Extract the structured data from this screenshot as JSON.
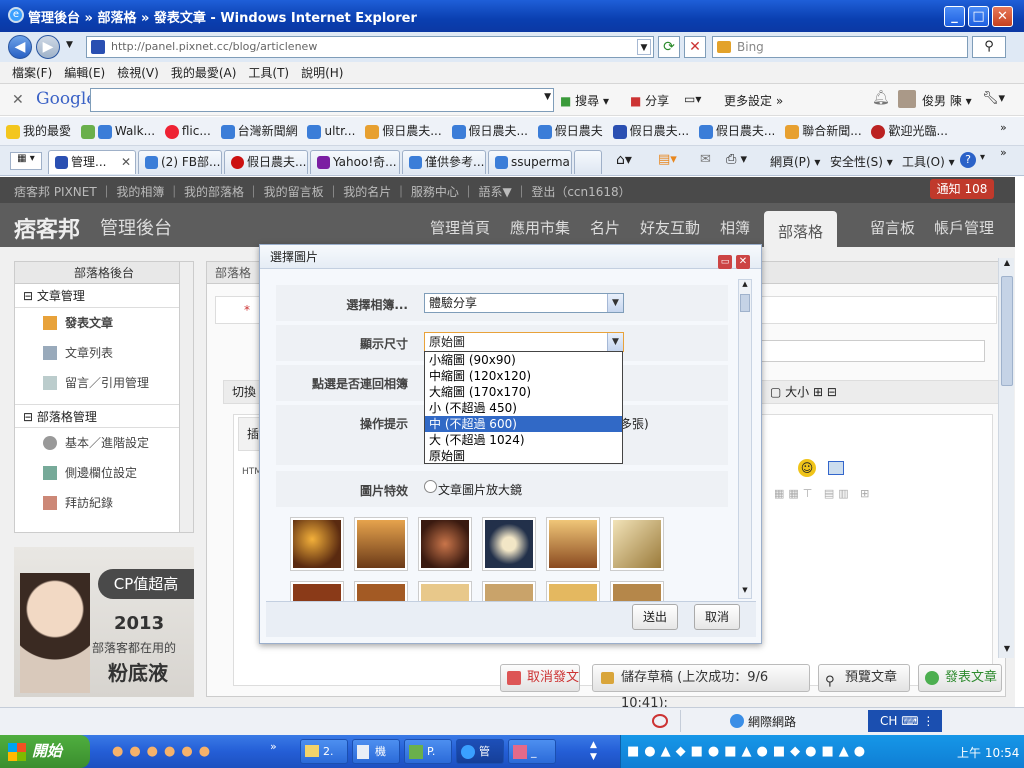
{
  "window": {
    "title": "管理後台 » 部落格 » 發表文章 - Windows Internet Explorer"
  },
  "address": {
    "url": "http://panel.pixnet.cc/blog/articlenew",
    "search_placeholder": "Bing"
  },
  "menubar": [
    "檔案(F)",
    "編輯(E)",
    "檢視(V)",
    "我的最愛(A)",
    "工具(T)",
    "說明(H)"
  ],
  "google_bar": {
    "logo": "Google",
    "search": "搜尋",
    "share": "分享",
    "more": "更多設定 »",
    "user": "俊男 陳"
  },
  "favorites": {
    "label": "我的最愛",
    "items": [
      "Walk...",
      "flic...",
      "台灣新聞網",
      "ultr...",
      "假日農夫...",
      "假日農夫...",
      "假日農夫",
      "假日農夫...",
      "假日農夫...",
      "聯合新聞...",
      "歡迎光臨..."
    ]
  },
  "tabs": [
    "管理...",
    "(2) FB部...",
    "假日農夫...",
    "Yahoo!奇...",
    "僅供參考...",
    "ssuperma..."
  ],
  "ie_commands": {
    "page": "網頁(P)",
    "safety": "安全性(S)",
    "tools": "工具(O)"
  },
  "pixnet": {
    "topbar": "痞客邦 PIXNET ｜ 我的相簿 ｜ 我的部落格 ｜ 我的留言板 ｜ 我的名片 ｜ 服務中心 ｜ 語系▼ ｜ 登出（ccn1618）",
    "notify": "通知 108",
    "logo": "痞客邦",
    "admin": "管理後台",
    "nav": [
      "管理首頁",
      "應用市集",
      "名片",
      "好友互動",
      "相簿",
      "部落格",
      "留言板",
      "帳戶管理"
    ]
  },
  "sidebar": {
    "title": "部落格後台",
    "section1": "文章管理",
    "items1": [
      "發表文章",
      "文章列表",
      "留言／引用管理"
    ],
    "section2": "部落格管理",
    "items2": [
      "基本／進階設定",
      "側邊欄位設定",
      "拜訪紀錄"
    ]
  },
  "ad": {
    "line1": "CP值超高",
    "line2": "2013",
    "line3": "部落客都在用的",
    "line4": "粉底液"
  },
  "main": {
    "crumb": "部落格",
    "switch": "切換",
    "insert": "插",
    "html": "HTML",
    "size": "大小"
  },
  "actions": {
    "cancel": "取消發文",
    "save": "儲存草稿 (上次成功：9/6 10:41):",
    "preview": "預覽文章",
    "publish": "發表文章"
  },
  "dialog": {
    "title": "選擇圖片",
    "album_label": "選擇相簿...",
    "album_value": "體驗分享",
    "size_label": "顯示尺寸",
    "size_value": "原始圖",
    "link_label": "點選是否連回相簿",
    "hint_label": "操作提示",
    "hint_tail": "多張)",
    "effect_label": "圖片特效",
    "effect_option": "文章圖片放大鏡",
    "size_options": [
      "小縮圖 (90x90)",
      "中縮圖 (120x120)",
      "大縮圖 (170x170)",
      "小 (不超過 450)",
      "中 (不超過 600)",
      "大 (不超過 1024)",
      "原始圖"
    ],
    "highlighted_index": 4,
    "submit": "送出",
    "cancel": "取消"
  },
  "status": {
    "zone": "網際網路",
    "lang": "CH"
  },
  "taskbar": {
    "start": "開始",
    "buttons": [
      "2.",
      "機",
      "P.",
      "管",
      "_"
    ],
    "clock": "上午 10:54"
  }
}
